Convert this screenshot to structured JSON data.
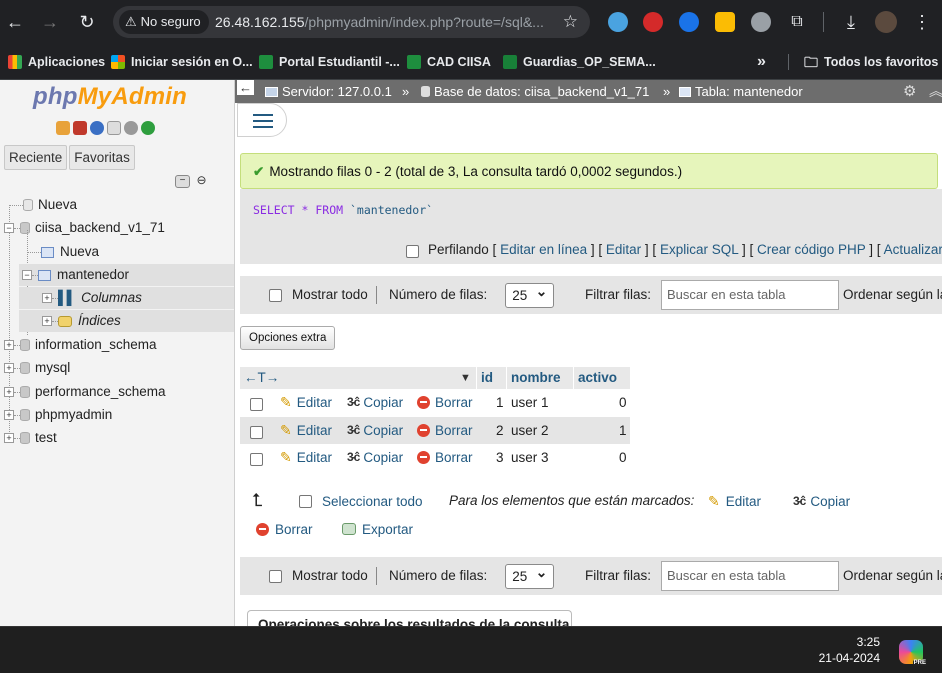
{
  "browser": {
    "security_chip": "No seguro",
    "url_host": "26.48.162.155",
    "url_path": "/phpmyadmin/index.php?route=/sql&..."
  },
  "bookmarks": {
    "items": [
      {
        "label": "Aplicaciones"
      },
      {
        "label": "Iniciar sesión en O..."
      },
      {
        "label": "Portal Estudiantil -..."
      },
      {
        "label": "CAD CIISA"
      },
      {
        "label": "Guardias_OP_SEMA..."
      }
    ],
    "more": "»",
    "all_bookmarks": "Todos los favoritos"
  },
  "sidebar": {
    "logo_php": "php",
    "logo_myadmin": "MyAdmin",
    "tab_recent": "Reciente",
    "tab_favorites": "Favoritas",
    "tree": {
      "new": "Nueva",
      "db_main": "ciisa_backend_v1_71",
      "db_new": "Nueva",
      "table": "mantenedor",
      "columns": "Columnas",
      "indexes": "Índices",
      "other_dbs": [
        "information_schema",
        "mysql",
        "performance_schema",
        "phpmyadmin",
        "test"
      ]
    }
  },
  "breadcrumb": {
    "server": "Servidor: 127.0.0.1",
    "database": "Base de datos: ciisa_backend_v1_71",
    "table": "Tabla: mantenedor",
    "sep": "»"
  },
  "result": {
    "success_message": "Mostrando filas 0 - 2 (total de 3, La consulta tardó 0,0002 segundos.)",
    "sql_select": "SELECT",
    "sql_star": "*",
    "sql_from": "FROM",
    "sql_table": "`mantenedor`",
    "profiling": "Perfilando",
    "links": [
      "Editar en línea",
      "Editar",
      "Explicar SQL",
      "Crear código PHP",
      "Actualizar"
    ]
  },
  "navbar": {
    "show_all": "Mostrar todo",
    "rows_label": "Número de filas:",
    "rows_value": "25",
    "filter_label": "Filtrar filas:",
    "filter_placeholder": "Buscar en esta tabla",
    "sort_label": "Ordenar según la"
  },
  "extra_options": "Opciones extra",
  "table": {
    "columns": [
      "id",
      "nombre",
      "activo"
    ],
    "actions": {
      "edit": "Editar",
      "copy": "Copiar",
      "delete": "Borrar"
    },
    "rows": [
      {
        "id": "1",
        "nombre": "user 1",
        "activo": "0"
      },
      {
        "id": "2",
        "nombre": "user 2",
        "activo": "1"
      },
      {
        "id": "3",
        "nombre": "user 3",
        "activo": "0"
      }
    ]
  },
  "bulk": {
    "select_all": "Seleccionar todo",
    "marked_label": "Para los elementos que están marcados:",
    "edit": "Editar",
    "copy": "Copiar",
    "delete": "Borrar",
    "export": "Exportar"
  },
  "operations_title": "Operaciones sobre los resultados de la consulta",
  "taskbar": {
    "time": "3:25",
    "date": "21-04-2024",
    "copilot_badge": "PRE"
  },
  "colors": {
    "link": "#235a81",
    "success_bg": "#e6f5bb",
    "logo_php": "#6c78af",
    "logo_myadmin": "#f89c0e"
  }
}
